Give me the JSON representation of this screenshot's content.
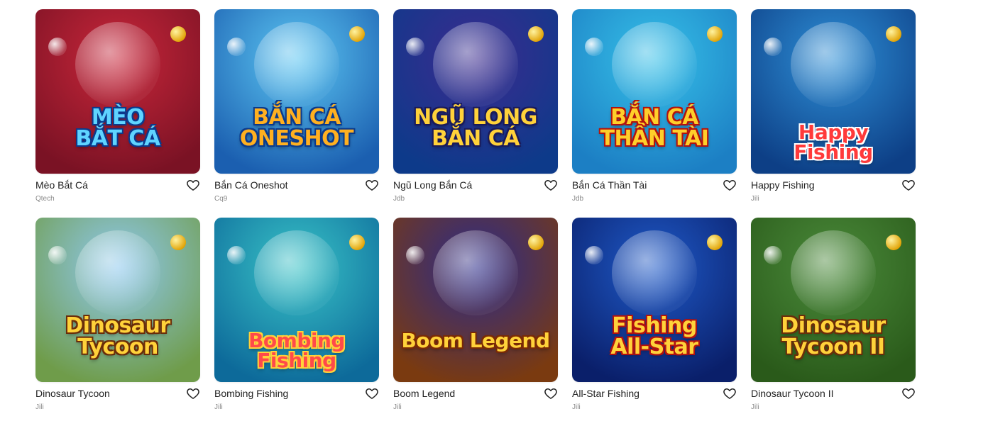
{
  "games": [
    {
      "title": "Mèo Bắt Cá",
      "provider": "Qtech",
      "art_text": [
        "MÈO",
        "BẮT CÁ"
      ],
      "art_colors": {
        "bg1": "#c8263a",
        "bg2": "#7a1224",
        "text": "#5fd4ff",
        "stroke": "#0b3a8c"
      }
    },
    {
      "title": "Bắn Cá Oneshot",
      "provider": "Cq9",
      "art_text": [
        "BẮN CÁ",
        "ONESHOT"
      ],
      "art_colors": {
        "bg1": "#5cc6f2",
        "bg2": "#1b5fb0",
        "text": "#ffb020",
        "stroke": "#0b3a8c"
      }
    },
    {
      "title": "Ngũ Long Bắn Cá",
      "provider": "Jdb",
      "art_text": [
        "NGŨ LONG",
        "BẮN CÁ"
      ],
      "art_colors": {
        "bg1": "#3b2b8f",
        "bg2": "#0d3a8a",
        "text": "#ffd23a",
        "stroke": "#1a1a5a"
      }
    },
    {
      "title": "Bắn Cá Thần Tài",
      "provider": "Jdb",
      "art_text": [
        "BẮN CÁ",
        "THẦN TÀI"
      ],
      "art_colors": {
        "bg1": "#36c0e8",
        "bg2": "#1c7fc4",
        "text": "#ffcf2a",
        "stroke": "#b3120e"
      }
    },
    {
      "title": "Happy Fishing",
      "provider": "Jili",
      "art_text": [
        "Happy Fishing"
      ],
      "art_colors": {
        "bg1": "#2e8fd6",
        "bg2": "#0d3f86",
        "text": "#ff3a3a",
        "stroke": "#ffffff"
      }
    },
    {
      "title": "Dinosaur Tycoon",
      "provider": "Jili",
      "art_text": [
        "Dinosaur",
        "Tycoon"
      ],
      "art_colors": {
        "bg1": "#8fc9ef",
        "bg2": "#6f9c4a",
        "text": "#ffd23a",
        "stroke": "#6a2d0a"
      }
    },
    {
      "title": "Bombing Fishing",
      "provider": "Jili",
      "art_text": [
        "Bombing Fishing"
      ],
      "art_colors": {
        "bg1": "#39c3c7",
        "bg2": "#0d6a9a",
        "text": "#ff4a4a",
        "stroke": "#ffd23a"
      }
    },
    {
      "title": "Boom Legend",
      "provider": "Jili",
      "art_text": [
        "Boom Legend"
      ],
      "art_colors": {
        "bg1": "#2b2b8a",
        "bg2": "#7a3a10",
        "text": "#ffd23a",
        "stroke": "#7a2a05"
      }
    },
    {
      "title": "All-Star Fishing",
      "provider": "Jili",
      "art_text": [
        "Fishing",
        "All-Star"
      ],
      "art_colors": {
        "bg1": "#1f5ac8",
        "bg2": "#0a1f6a",
        "text": "#ffd23a",
        "stroke": "#b3120e"
      }
    },
    {
      "title": "Dinosaur Tycoon II",
      "provider": "Jili",
      "art_text": [
        "Dinosaur",
        "Tycoon II"
      ],
      "art_colors": {
        "bg1": "#4a8a3a",
        "bg2": "#2a5a1a",
        "text": "#ffd23a",
        "stroke": "#6a2d0a"
      }
    }
  ],
  "favorite_icon": "heart-outline-icon",
  "colors": {
    "title_text": "#222222",
    "provider_text": "#8a8a8a",
    "heart_stroke": "#222222"
  }
}
